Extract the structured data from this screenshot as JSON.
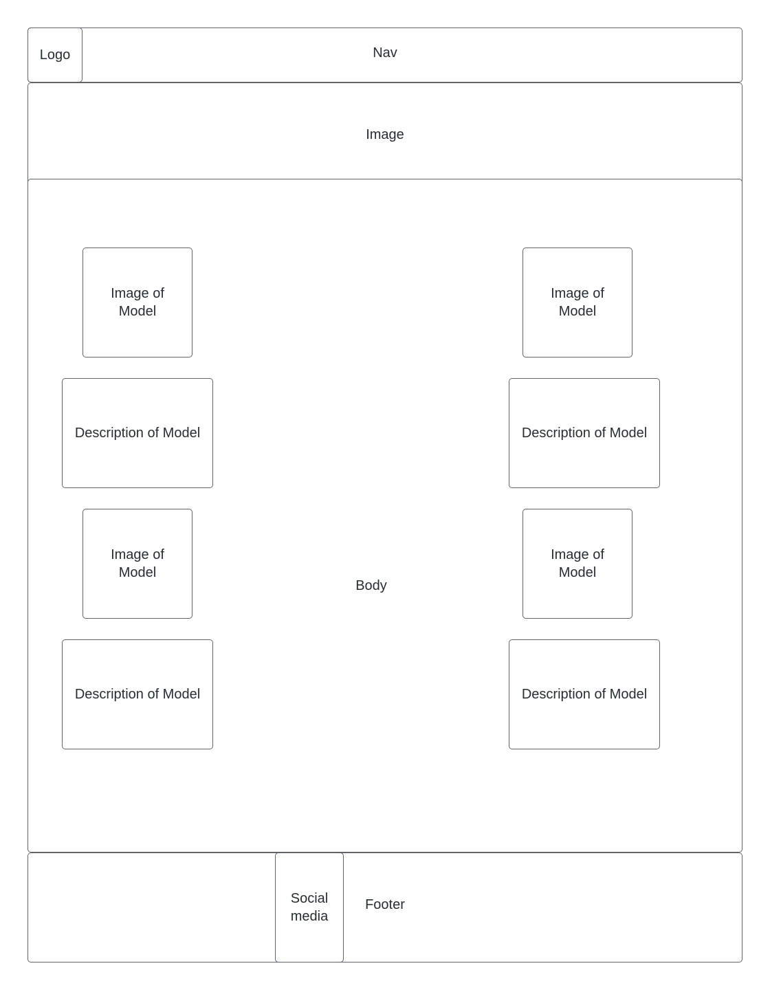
{
  "diagram": {
    "type": "website-wireframe",
    "header": {
      "logo_label": "Logo",
      "nav_label": "Nav"
    },
    "hero": {
      "label": "Image"
    },
    "body": {
      "label": "Body",
      "cards": [
        {
          "image_label": "Image of\nModel",
          "description_label": "Description of Model"
        },
        {
          "image_label": "Image of\nModel",
          "description_label": "Description of Model"
        },
        {
          "image_label": "Image of\nModel",
          "description_label": "Description of Model"
        },
        {
          "image_label": "Image of\nModel",
          "description_label": "Description of Model"
        }
      ]
    },
    "footer": {
      "social_label": "Social\nmedia",
      "label": "Footer"
    }
  }
}
